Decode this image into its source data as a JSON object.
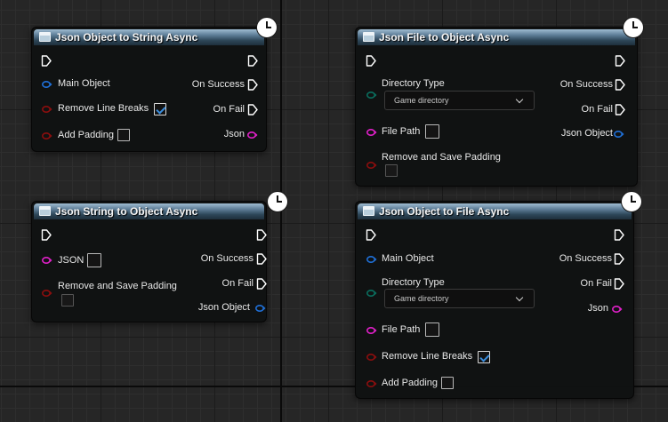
{
  "nodes": [
    {
      "title": "Json Object to String Async",
      "inputs": {
        "main_object": "Main Object",
        "remove_line_breaks": "Remove Line Breaks",
        "add_padding": "Add Padding"
      },
      "outputs": {
        "on_success": "On Success",
        "on_fail": "On Fail",
        "json": "Json"
      },
      "values": {
        "remove_line_breaks": true,
        "add_padding": false
      }
    },
    {
      "title": "Json File to Object Async",
      "inputs": {
        "directory_type": "Directory Type",
        "file_path": "File Path",
        "remove_and_save_padding": "Remove and Save Padding"
      },
      "outputs": {
        "on_success": "On Success",
        "on_fail": "On Fail",
        "json_object": "Json Object"
      },
      "values": {
        "directory_type": "Game directory",
        "file_path": "",
        "remove_and_save_padding": false
      }
    },
    {
      "title": "Json String to Object Async",
      "inputs": {
        "json": "JSON",
        "remove_and_save_padding": "Remove and Save Padding"
      },
      "outputs": {
        "on_success": "On Success",
        "on_fail": "On Fail",
        "json_object": "Json Object"
      },
      "values": {
        "json": "",
        "remove_and_save_padding": false
      }
    },
    {
      "title": "Json Object to File Async",
      "inputs": {
        "main_object": "Main Object",
        "directory_type": "Directory Type",
        "file_path": "File Path",
        "remove_line_breaks": "Remove Line Breaks",
        "add_padding": "Add Padding"
      },
      "outputs": {
        "on_success": "On Success",
        "on_fail": "On Fail",
        "json": "Json"
      },
      "values": {
        "directory_type": "Game directory",
        "file_path": "",
        "remove_line_breaks": true,
        "add_padding": false
      }
    }
  ],
  "colors": {
    "object_pin": "#1f6fd6",
    "bool_pin": "#8c0e0e",
    "string_pin": "#e020c8",
    "enum_pin": "#0a6e5e",
    "header": "#2d4658",
    "check_accent": "#3a8ddc"
  },
  "icons": [
    "function-icon",
    "latent-clock-icon",
    "exec-pin-icon",
    "checkbox-icon",
    "chevron-down-icon"
  ]
}
